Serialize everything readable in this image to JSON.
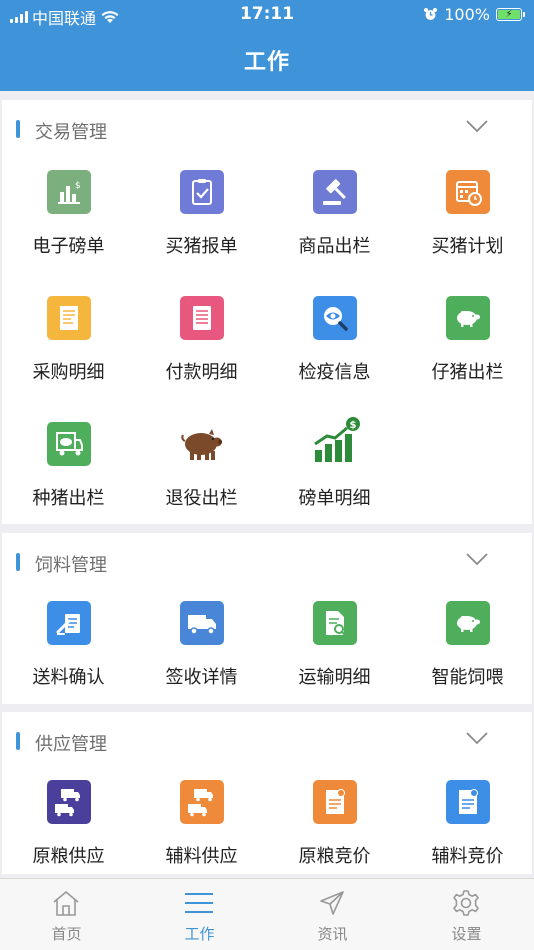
{
  "status_bar": {
    "carrier": "中国联通",
    "time": "17:11",
    "battery_percent": "100%",
    "battery_level": 1.0
  },
  "header": {
    "title": "工作"
  },
  "sections": [
    {
      "title": "交易管理",
      "items": [
        {
          "label": "电子磅单",
          "icon": "chart-dollar-icon",
          "color": "#7bb07e"
        },
        {
          "label": "买猪报单",
          "icon": "clipboard-check-icon",
          "color": "#6f7bd6"
        },
        {
          "label": "商品出栏",
          "icon": "gavel-icon",
          "color": "#6e7bd4"
        },
        {
          "label": "买猪计划",
          "icon": "calendar-clock-icon",
          "color": "#ef8a3b"
        },
        {
          "label": "采购明细",
          "icon": "receipt-icon",
          "color": "#f5b63e"
        },
        {
          "label": "付款明细",
          "icon": "document-list-icon",
          "color": "#e8577d"
        },
        {
          "label": "检疫信息",
          "icon": "magnifier-eye-icon",
          "color": "#3c8ee6"
        },
        {
          "label": "仔猪出栏",
          "icon": "piglet-icon",
          "color": "#4eae5b"
        },
        {
          "label": "种猪出栏",
          "icon": "pig-truck-icon",
          "color": "#4eae5b"
        },
        {
          "label": "退役出栏",
          "icon": "brown-pig-icon",
          "color": "#7a4a2a"
        },
        {
          "label": "磅单明细",
          "icon": "growth-chart-icon",
          "color": "#2e8b3a"
        }
      ]
    },
    {
      "title": "饲料管理",
      "items": [
        {
          "label": "送料确认",
          "icon": "sign-document-icon",
          "color": "#3c8ee6"
        },
        {
          "label": "签收详情",
          "icon": "delivery-truck-icon",
          "color": "#4a86d8"
        },
        {
          "label": "运输明细",
          "icon": "file-search-icon",
          "color": "#4eae5b"
        },
        {
          "label": "智能饲喂",
          "icon": "pig-feed-icon",
          "color": "#4eae5b"
        }
      ]
    },
    {
      "title": "供应管理",
      "items": [
        {
          "label": "原粮供应",
          "icon": "trucks-icon",
          "color": "#4a3f9a"
        },
        {
          "label": "辅料供应",
          "icon": "trucks-orange-icon",
          "color": "#ef8a3b"
        },
        {
          "label": "原粮竞价",
          "icon": "bid-document-icon",
          "color": "#ef8a3b"
        },
        {
          "label": "辅料竞价",
          "icon": "bid-document-blue-icon",
          "color": "#3c8ee6"
        }
      ]
    }
  ],
  "tabbar": {
    "tabs": [
      {
        "label": "首页",
        "icon": "home-icon"
      },
      {
        "label": "工作",
        "icon": "menu-lines-icon",
        "active": true
      },
      {
        "label": "资讯",
        "icon": "paper-plane-icon"
      },
      {
        "label": "设置",
        "icon": "gear-icon"
      }
    ]
  },
  "colors": {
    "accent": "#3f93d8",
    "background": "#eeeef2"
  }
}
